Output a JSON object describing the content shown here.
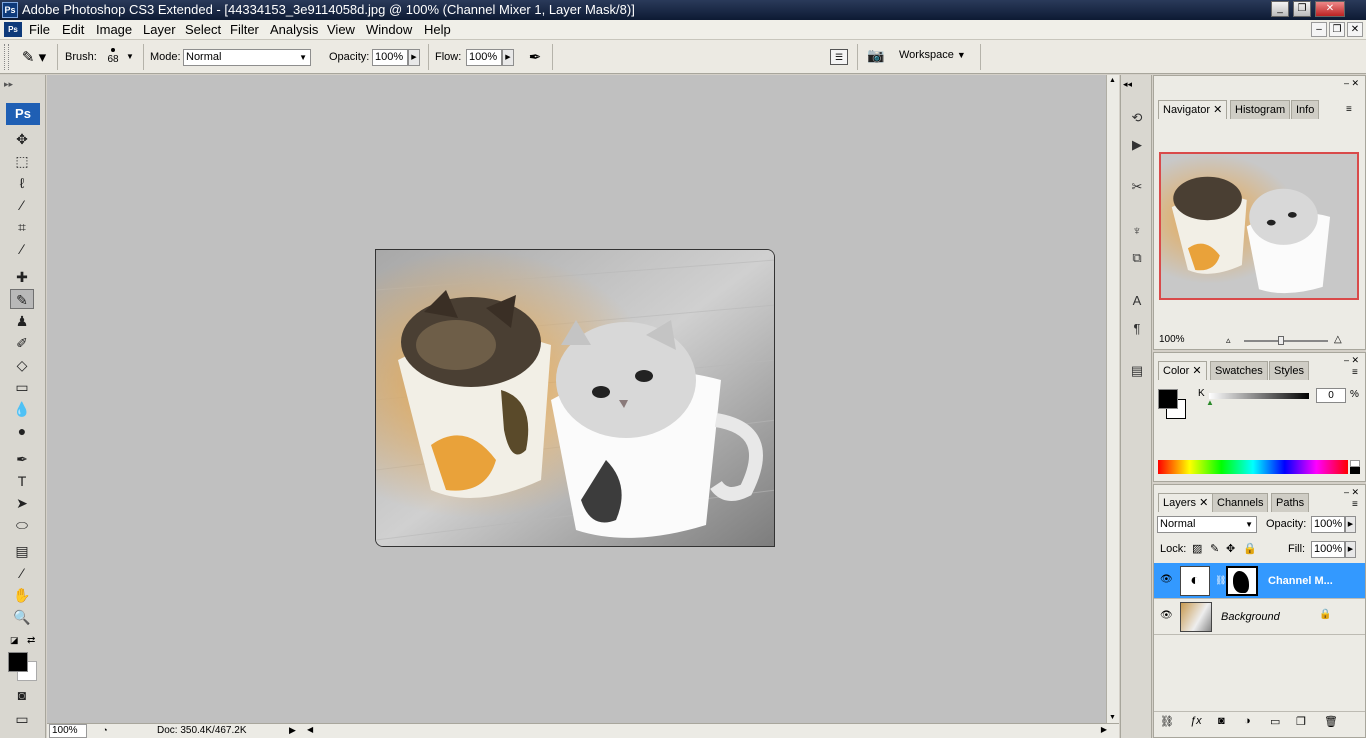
{
  "window": {
    "title": "Adobe Photoshop CS3 Extended - [44334153_3e9114058d.jpg @ 100% (Channel Mixer 1, Layer Mask/8)]",
    "app_badge": "Ps",
    "minimize": "_",
    "restore": "❐",
    "close": "✕"
  },
  "menu": {
    "items": [
      "File",
      "Edit",
      "Image",
      "Layer",
      "Select",
      "Filter",
      "Analysis",
      "View",
      "Window",
      "Help"
    ]
  },
  "options": {
    "brush_label": "Brush:",
    "brush_size": "68",
    "mode_label": "Mode:",
    "mode_value": "Normal",
    "opacity_label": "Opacity:",
    "opacity_value": "100%",
    "flow_label": "Flow:",
    "flow_value": "100%",
    "workspace_label": "Workspace"
  },
  "toolbox": {
    "logo": "Ps"
  },
  "status": {
    "zoom": "100%",
    "doc": "Doc: 350.4K/467.2K"
  },
  "navigator": {
    "tabs": [
      "Navigator",
      "Histogram",
      "Info"
    ],
    "zoom": "100%"
  },
  "color": {
    "tabs": [
      "Color",
      "Swatches",
      "Styles"
    ],
    "channel": "K",
    "value": "0",
    "unit": "%"
  },
  "layers": {
    "tabs": [
      "Layers",
      "Channels",
      "Paths"
    ],
    "blend_mode": "Normal",
    "opacity_label": "Opacity:",
    "opacity_value": "100%",
    "lock_label": "Lock:",
    "fill_label": "Fill:",
    "fill_value": "100%",
    "rows": [
      {
        "name": "Channel M...",
        "selected": true
      },
      {
        "name": "Background",
        "selected": false
      }
    ]
  },
  "colors": {
    "accent": "#3399ff",
    "canvas": "#c0c0c0",
    "nav_frame": "#d94a4a"
  }
}
